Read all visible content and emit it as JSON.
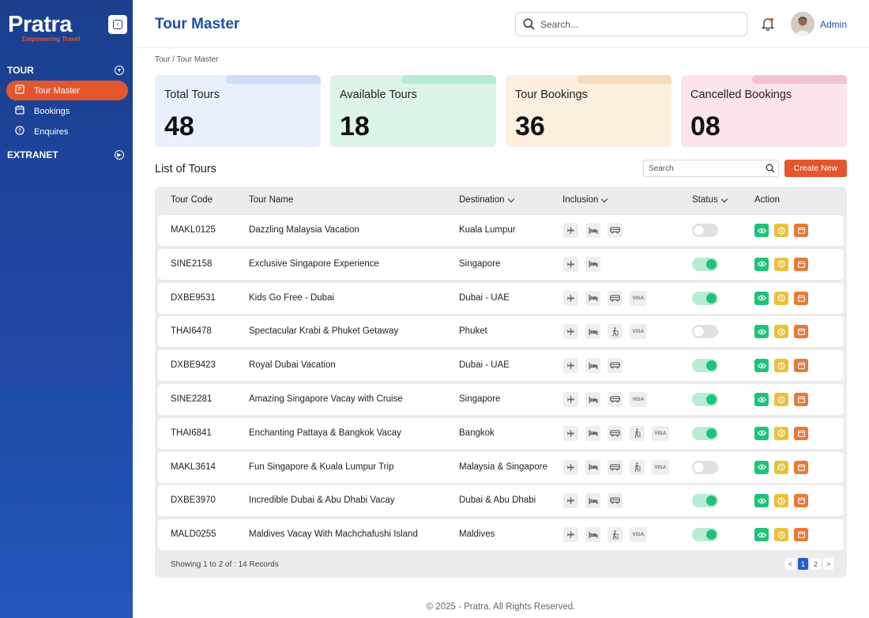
{
  "sidebar": {
    "logo_text": "Pratra",
    "logo_tagline": "Empowering Travel",
    "sections": [
      {
        "label": "TOUR",
        "items": [
          {
            "label": "Tour Master",
            "icon": "notepad-icon",
            "active": true
          },
          {
            "label": "Bookings",
            "icon": "calendar-icon",
            "active": false
          },
          {
            "label": "Enquires",
            "icon": "question-icon",
            "active": false
          }
        ]
      },
      {
        "label": "EXTRANET",
        "items": []
      }
    ]
  },
  "header": {
    "title": "Tour Master",
    "search_placeholder": "Search...",
    "user_name": "Admin"
  },
  "breadcrumb": "Tour / Tour Master",
  "stats": [
    {
      "label": "Total Tours",
      "value": "48",
      "bg": "#e9effb",
      "tab": "#cfdcf5"
    },
    {
      "label": "Available Tours",
      "value": "18",
      "bg": "#dcf5e8",
      "tab": "#b8ecd2"
    },
    {
      "label": "Tour Bookings",
      "value": "36",
      "bg": "#fdefdd",
      "tab": "#f6dcbc"
    },
    {
      "label": "Cancelled Bookings",
      "value": "08",
      "bg": "#fde4ec",
      "tab": "#f3c2d1"
    }
  ],
  "list": {
    "title": "List of Tours",
    "search_placeholder": "Search",
    "create_label": "Create New"
  },
  "table": {
    "columns": [
      "Tour Code",
      "Tour Name",
      "Destination",
      "Inclusion",
      "Status",
      "Action"
    ],
    "rows": [
      {
        "code": "MAKL0125",
        "name": "Dazzling Malaysia Vacation",
        "destination": "Kuala Lumpur",
        "inclusions": [
          "flight",
          "hotel",
          "transfer"
        ],
        "status": false
      },
      {
        "code": "SINE2158",
        "name": "Exclusive Singapore Experience",
        "destination": "Singapore",
        "inclusions": [
          "flight",
          "hotel"
        ],
        "status": true
      },
      {
        "code": "DXBE9531",
        "name": "Kids Go Free - Dubai",
        "destination": "Dubai - UAE",
        "inclusions": [
          "flight",
          "hotel",
          "transfer",
          "visa"
        ],
        "status": true
      },
      {
        "code": "THAI6478",
        "name": "Spectacular Krabi & Phuket Getaway",
        "destination": "Phuket",
        "inclusions": [
          "flight",
          "hotel",
          "sightseeing",
          "visa"
        ],
        "status": false
      },
      {
        "code": "DXBE9423",
        "name": "Royal Dubai Vacation",
        "destination": "Dubai - UAE",
        "inclusions": [
          "flight",
          "hotel",
          "transfer"
        ],
        "status": true
      },
      {
        "code": "SINE2281",
        "name": "Amazing Singapore Vacay with Cruise",
        "destination": "Singapore",
        "inclusions": [
          "flight",
          "hotel",
          "transfer",
          "visa"
        ],
        "status": true
      },
      {
        "code": "THAI6841",
        "name": "Enchanting Pattaya & Bangkok Vacay",
        "destination": "Bangkok",
        "inclusions": [
          "flight",
          "hotel",
          "transfer",
          "sightseeing",
          "visa"
        ],
        "status": true
      },
      {
        "code": "MAKL3614",
        "name": "Fun Singapore & Kuala Lumpur Trip",
        "destination": "Malaysia & Singapore",
        "inclusions": [
          "flight",
          "hotel",
          "transfer",
          "sightseeing",
          "visa"
        ],
        "status": false
      },
      {
        "code": "DXBE3970",
        "name": "Incredible Dubai & Abu Dhabi Vacay",
        "destination": "Dubai & Abu Dhabi",
        "inclusions": [
          "flight",
          "hotel",
          "transfer"
        ],
        "status": true
      },
      {
        "code": "MALD0255",
        "name": "Maldives Vacay With Machchafushi Island",
        "destination": "Maldives",
        "inclusions": [
          "flight",
          "hotel",
          "sightseeing",
          "visa"
        ],
        "status": true
      }
    ],
    "visa_label": "VISA",
    "showing": "Showing 1 to 2 of : 14 Records",
    "pages": [
      "<",
      "1",
      "2",
      ">"
    ],
    "current_page": "1"
  },
  "footer": "© 2025 - Pratra. All Rights Reserved.",
  "colors": {
    "brand_blue": "#1e4fa6",
    "accent_orange": "#e4572e",
    "success_green": "#1fc27a",
    "price_yellow": "#e8c239"
  }
}
